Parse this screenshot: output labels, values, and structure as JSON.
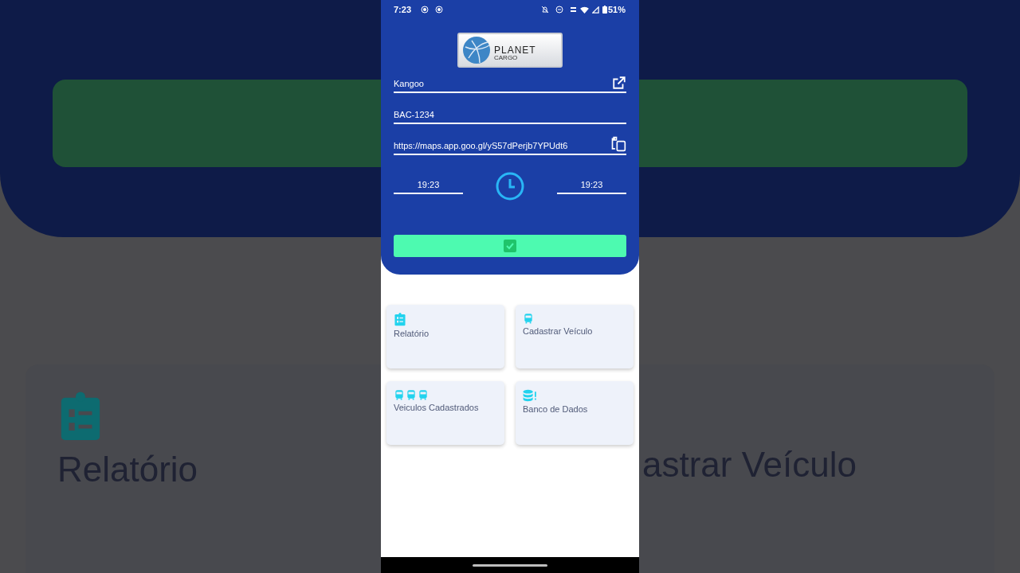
{
  "backdrop": {
    "left_label": "Relatório",
    "right_label": "astrar Veículo"
  },
  "status_bar": {
    "time": "7:23",
    "battery": "51%"
  },
  "logo": {
    "title": "PLANET",
    "subtitle": "CARGO"
  },
  "fields": [
    {
      "value": "Kangoo"
    },
    {
      "value": "BAC-1234"
    },
    {
      "value": "https://maps.app.goo.gl/yS57dPerjb7YPUdt6"
    }
  ],
  "times": {
    "start": "19:23",
    "end": "19:23"
  },
  "menu": [
    {
      "label": "Relatório"
    },
    {
      "label": "Cadastrar Veículo"
    },
    {
      "label": "Veiculos Cadastrados"
    },
    {
      "label": "Banco de Dados"
    }
  ]
}
